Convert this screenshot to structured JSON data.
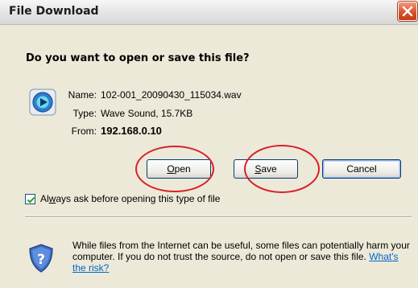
{
  "dialog": {
    "title": "File Download",
    "question": "Do you want to open or save this file?"
  },
  "file": {
    "name_label": "Name:",
    "name": "102-001_20090430_115034.wav",
    "type_label": "Type:",
    "type": "Wave Sound, 15.7KB",
    "from_label": "From:",
    "from": "192.168.0.10"
  },
  "buttons": {
    "open_prefix": "",
    "open_key": "O",
    "open_rest": "pen",
    "save_prefix": "",
    "save_key": "S",
    "save_rest": "ave",
    "cancel": "Cancel"
  },
  "checkbox": {
    "checked": true,
    "label_prefix": "Al",
    "label_key": "w",
    "label_rest": "ays ask before opening this type of file"
  },
  "warning": {
    "text": "While files from the Internet can be useful, some files can potentially harm your computer. If you do not trust the source, do not open or save this file. ",
    "link": "What's the risk?"
  },
  "annotations": {
    "color": "#d8202a"
  },
  "icons": {
    "close": "close-icon",
    "file": "media-file-icon",
    "checkmark": "checkmark-icon",
    "shield": "security-shield-icon"
  }
}
